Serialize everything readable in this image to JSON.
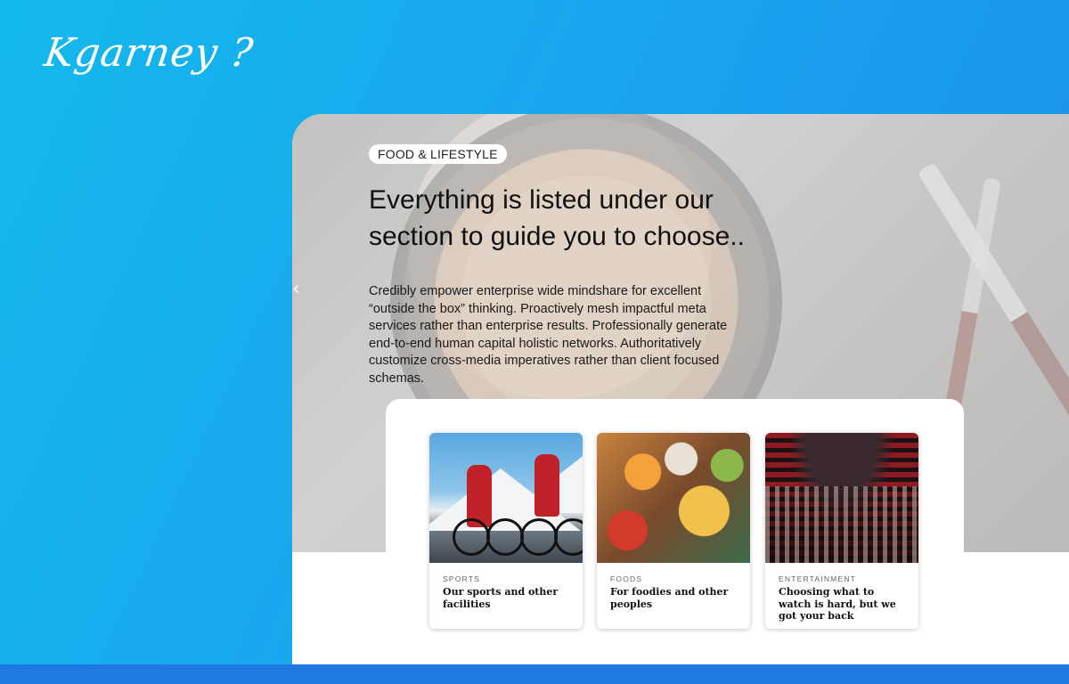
{
  "brand": {
    "logo": "Kgarney ?"
  },
  "hero": {
    "tag": "FOOD & LIFESTYLE",
    "headline": "Everything is listed under our section to guide you to choose..",
    "description": "Credibly empower enterprise wide mindshare for excellent “outside the box” thinking. Proactively mesh impactful meta services rather than enterprise results. Professionally generate end-to-end human capital holistic networks. Authoritatively customize cross-media imperatives rather than client focused schemas.",
    "prev_arrow": "‹"
  },
  "cards": [
    {
      "category": "SPORTS",
      "title": "Our sports and other facilities",
      "image": "cyclists-photo"
    },
    {
      "category": "FOODS",
      "title": "For foodies and other peoples",
      "image": "food-spread-photo"
    },
    {
      "category": "ENTERTAINMENT",
      "title": "Choosing what to watch is hard, but we got your back",
      "image": "cinema-audience-photo"
    }
  ],
  "colors": {
    "background_gradient_start": "#13b9ec",
    "background_gradient_end": "#1b8ce9",
    "bottom_bar": "#1f79e0",
    "panel": "#ffffff"
  }
}
